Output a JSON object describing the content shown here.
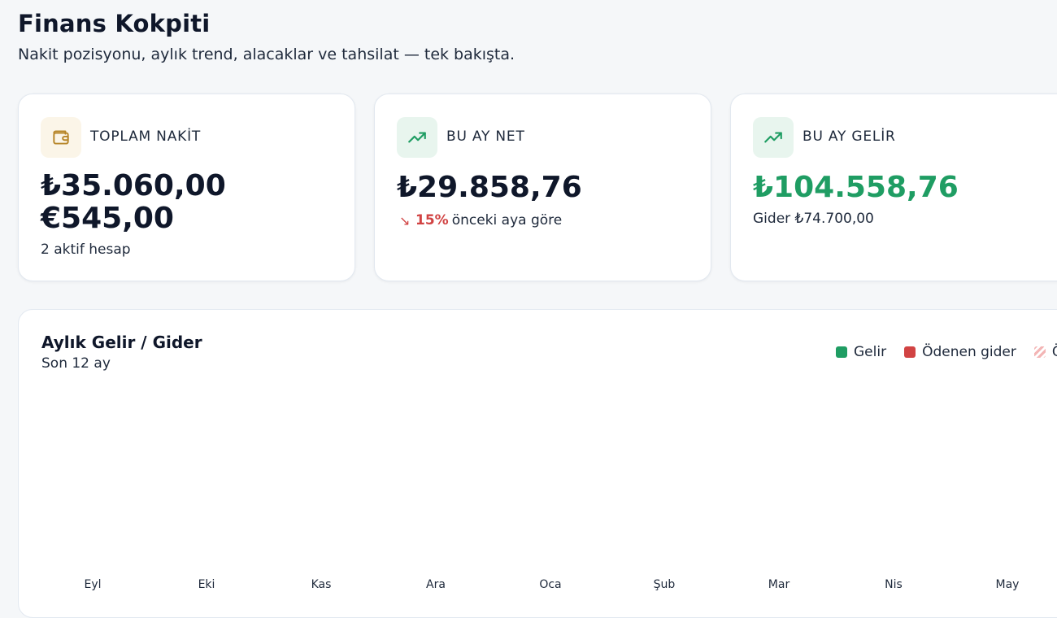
{
  "header": {
    "title": "Finans Kokpiti",
    "subtitle": "Nakit pozisyonu, aylık trend, alacaklar ve tahsilat — tek bakışta."
  },
  "cards": [
    {
      "label": "TOPLAM NAKİT",
      "icon": "wallet-icon",
      "values": [
        "₺35.060,00",
        "€545,00"
      ],
      "note": "2 aktif hesap"
    },
    {
      "label": "BU AY NET",
      "icon": "trending-up-icon",
      "value": "₺29.858,76",
      "delta": {
        "direction": "down",
        "percent": "15%",
        "text": "önceki aya göre"
      }
    },
    {
      "label": "BU AY GELİR",
      "icon": "trending-up-icon",
      "value": "₺104.558,76",
      "note": "Gider ₺74.700,00"
    }
  ],
  "chart": {
    "title": "Aylık Gelir / Gider",
    "subtitle": "Son 12 ay",
    "legend": [
      "Gelir",
      "Ödenen gider",
      "Ö"
    ],
    "months": [
      "Eyl",
      "Eki",
      "Kas",
      "Ara",
      "Oca",
      "Şub",
      "Mar",
      "Nis",
      "May"
    ]
  },
  "colors": {
    "gelir": "#1f9d63",
    "gider": "#d14343",
    "accent_wallet": "#b7862a"
  }
}
